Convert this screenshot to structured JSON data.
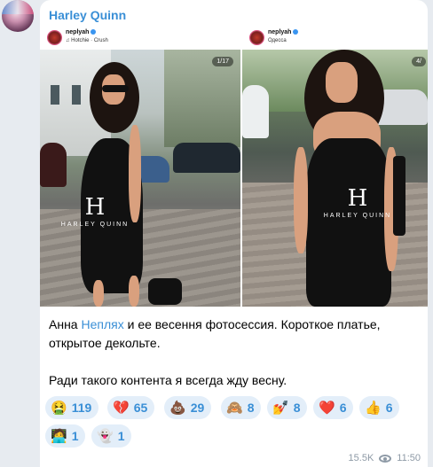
{
  "channel": {
    "name": "Harley Quinn"
  },
  "post": {
    "photos": [
      {
        "ig_user": "neplyah",
        "ig_sub": "♫ Hotchie · Crush",
        "counter": "1/17",
        "logo_letter": "H",
        "logo_text": "HARLEY QUINN"
      },
      {
        "ig_user": "neplyah",
        "ig_sub": "Одесса",
        "counter": "4/",
        "logo_letter": "H",
        "logo_text": "HARLEY QUINN"
      }
    ],
    "text_line1_pre": "Анна ",
    "text_link": "Неплях",
    "text_line1_post": " и ее весення фотосессия. Короткое платье, открытое декольте.",
    "text_line2": "Ради такого контента я всегда жду весну.",
    "reactions": [
      {
        "emoji": "🤮",
        "count": "119"
      },
      {
        "emoji": "💔",
        "count": "65"
      },
      {
        "emoji": "💩",
        "count": "29"
      },
      {
        "emoji": "🙈",
        "count": "8"
      },
      {
        "emoji": "💅",
        "count": "8"
      },
      {
        "emoji": "❤️",
        "count": "6"
      },
      {
        "emoji": "👍",
        "count": "6"
      },
      {
        "emoji": "🧑‍💻",
        "count": "1"
      },
      {
        "emoji": "👻",
        "count": "1"
      }
    ],
    "views": "15.5K",
    "time": "11:50"
  },
  "icons": {
    "views": "eye-icon",
    "verified": "verified-badge-icon",
    "more": "more-dots-icon"
  },
  "colors": {
    "link": "#3a8fd6",
    "reaction_bg": "#e3eef9",
    "background": "#e7ebf0"
  }
}
